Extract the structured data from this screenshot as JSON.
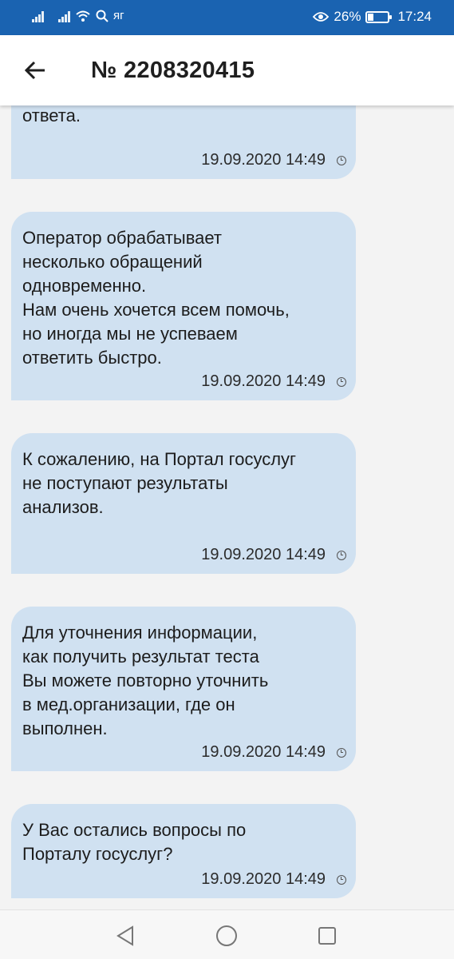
{
  "status_bar": {
    "battery": "26%",
    "time": "17:24",
    "carrier_glyph": "яг",
    "battery_level": 0.26
  },
  "header": {
    "title": "№ 2208320415"
  },
  "messages": [
    {
      "text": "ответа.",
      "time": "19.09.2020 14:49"
    },
    {
      "text": "Оператор обрабатывает\nнесколько обращений\nодновременно.\nНам очень хочется всем помочь,\nно иногда мы не успеваем\nответить быстро.",
      "time": "19.09.2020 14:49"
    },
    {
      "text": "К сожалению, на Портал госуслуг\nне поступают результаты\nанализов.",
      "time": "19.09.2020 14:49"
    },
    {
      "text": "Для уточнения информации,\nкак получить результат теста\nВы можете повторно уточнить\nв мед.организации, где он\nвыполнен.",
      "time": "19.09.2020 14:49"
    },
    {
      "text": "У Вас остались вопросы по\nПорталу госуслуг?",
      "time": "19.09.2020 14:49"
    }
  ],
  "colors": {
    "status_bar": "#1a63b1",
    "bubble": "#d0e1f1",
    "background": "#f3f3f3"
  }
}
